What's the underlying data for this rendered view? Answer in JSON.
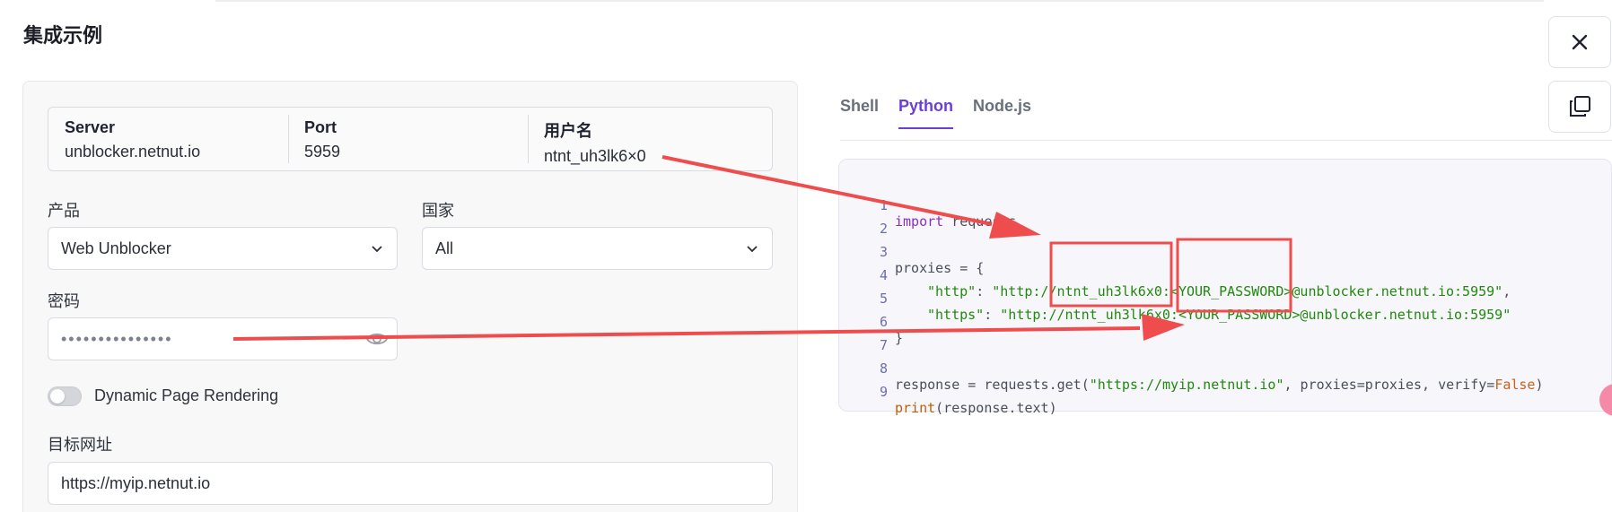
{
  "dialog": {
    "title": "集成示例"
  },
  "icons": {
    "close": "close-icon",
    "copy": "copy-icon",
    "chevron": "chevron-down-icon",
    "eye": "eye-icon"
  },
  "connection": {
    "server": {
      "label": "Server",
      "value": "unblocker.netnut.io"
    },
    "port": {
      "label": "Port",
      "value": "5959"
    },
    "username": {
      "label": "用户名",
      "value": "ntnt_uh3lk6×0"
    }
  },
  "form": {
    "product": {
      "label": "产品",
      "value": "Web Unblocker"
    },
    "country": {
      "label": "国家",
      "value": "All"
    },
    "password": {
      "label": "密码",
      "masked": "•••••••••••••••"
    },
    "rendering": {
      "label": "Dynamic Page Rendering",
      "enabled": false
    },
    "target_url": {
      "label": "目标网址",
      "value": "https://myip.netnut.io"
    }
  },
  "tabs": [
    {
      "label": "Shell",
      "active": false
    },
    {
      "label": "Python",
      "active": true
    },
    {
      "label": "Node.js",
      "active": false
    }
  ],
  "code": {
    "language": "Python",
    "line_numbers": [
      "1",
      "2",
      "3",
      "4",
      "5",
      "6",
      "7",
      "8",
      "9"
    ],
    "l1_kw": "import",
    "l1_rest": " requests",
    "l3": "proxies = {",
    "l4_key": "\"http\"",
    "l4_sep": ": ",
    "l4_val": "\"http://ntnt_uh3lk6x0:<YOUR_PASSWORD>@unblocker.netnut.io:5959\"",
    "l4_end": ",",
    "l5_key": "\"https\"",
    "l5_sep": ": ",
    "l5_val": "\"http://ntnt_uh3lk6x0:<YOUR_PASSWORD>@unblocker.netnut.io:5959\"",
    "l6": "}",
    "l8_a": "response = requests.get(",
    "l8_str": "\"https://myip.netnut.io\"",
    "l8_b": ", proxies=proxies, verify=",
    "l8_bool": "False",
    "l8_c": ")",
    "l9_fn": "print",
    "l9_rest": "(response.text)"
  },
  "annotation_color": "#ef4d4d",
  "accent_color": "#6b3fd4"
}
